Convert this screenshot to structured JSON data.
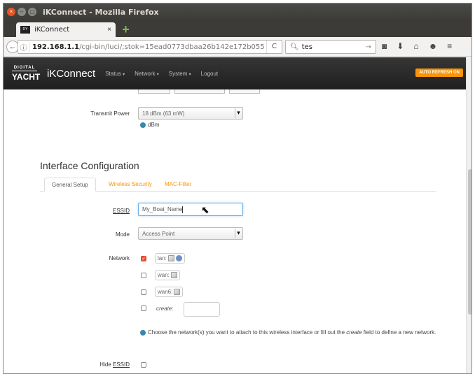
{
  "window": {
    "title": "iKConnect - Mozilla Firefox"
  },
  "browser": {
    "tab_title": "iKConnect",
    "tab_close": "×",
    "new_tab": "+",
    "url_host": "192.168.1.1",
    "url_path": "/cgi-bin/luci/;stok=15ead0773dbaa26b142e172b055",
    "search_value": "tes",
    "reload": "C"
  },
  "app": {
    "logo_top": "DIGITAL",
    "logo_bottom": "YACHT",
    "brand": "iKConnect",
    "nav": [
      {
        "label": "Status"
      },
      {
        "label": "Network"
      },
      {
        "label": "System"
      },
      {
        "label": "Logout"
      }
    ],
    "auto_refresh": "AUTO REFRESH ON"
  },
  "transmit_power": {
    "label": "Transmit Power",
    "value": "18 dBm (63 mW)",
    "hint": "dBm"
  },
  "interface_config": {
    "title": "Interface Configuration",
    "tabs": [
      {
        "label": "General Setup",
        "active": true
      },
      {
        "label": "Wireless Security",
        "active": false
      },
      {
        "label": "MAC-Filter",
        "active": false
      }
    ]
  },
  "essid": {
    "label": "ESSID",
    "value": "My_Boat_Name"
  },
  "mode": {
    "label": "Mode",
    "value": "Access Point"
  },
  "network": {
    "label": "Network",
    "options": [
      {
        "name": "lan:",
        "checked": true
      },
      {
        "name": "wan:",
        "checked": false
      },
      {
        "name": "wan6:",
        "checked": false
      }
    ],
    "create_label": "create:",
    "help_before": "Choose the network(s) you want to attach to this wireless interface or fill out the",
    "help_em": "create",
    "help_after": "field to define a new network."
  },
  "hide_essid": {
    "label": "Hide ESSID"
  },
  "colors": {
    "accent_orange": "#f89406",
    "ubuntu_orange": "#e95420",
    "header_dark": "#2b2b2b",
    "focus_blue": "#66afe9"
  }
}
